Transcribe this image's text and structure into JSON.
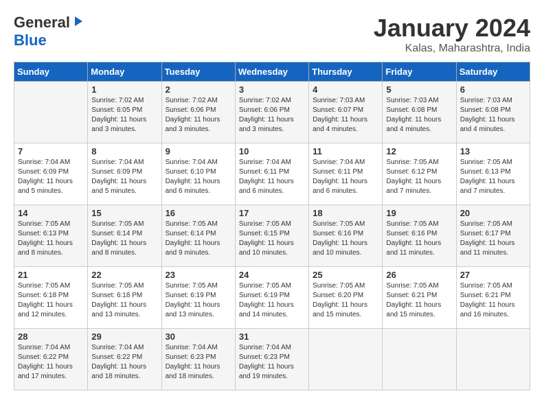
{
  "header": {
    "logo_general": "General",
    "logo_blue": "Blue",
    "title": "January 2024",
    "subtitle": "Kalas, Maharashtra, India"
  },
  "days_of_week": [
    "Sunday",
    "Monday",
    "Tuesday",
    "Wednesday",
    "Thursday",
    "Friday",
    "Saturday"
  ],
  "weeks": [
    {
      "cells": [
        {
          "day": null,
          "info": null
        },
        {
          "day": "1",
          "info": "Sunrise: 7:02 AM\nSunset: 6:05 PM\nDaylight: 11 hours\nand 3 minutes."
        },
        {
          "day": "2",
          "info": "Sunrise: 7:02 AM\nSunset: 6:06 PM\nDaylight: 11 hours\nand 3 minutes."
        },
        {
          "day": "3",
          "info": "Sunrise: 7:02 AM\nSunset: 6:06 PM\nDaylight: 11 hours\nand 3 minutes."
        },
        {
          "day": "4",
          "info": "Sunrise: 7:03 AM\nSunset: 6:07 PM\nDaylight: 11 hours\nand 4 minutes."
        },
        {
          "day": "5",
          "info": "Sunrise: 7:03 AM\nSunset: 6:08 PM\nDaylight: 11 hours\nand 4 minutes."
        },
        {
          "day": "6",
          "info": "Sunrise: 7:03 AM\nSunset: 6:08 PM\nDaylight: 11 hours\nand 4 minutes."
        }
      ]
    },
    {
      "cells": [
        {
          "day": "7",
          "info": "Sunrise: 7:04 AM\nSunset: 6:09 PM\nDaylight: 11 hours\nand 5 minutes."
        },
        {
          "day": "8",
          "info": "Sunrise: 7:04 AM\nSunset: 6:09 PM\nDaylight: 11 hours\nand 5 minutes."
        },
        {
          "day": "9",
          "info": "Sunrise: 7:04 AM\nSunset: 6:10 PM\nDaylight: 11 hours\nand 6 minutes."
        },
        {
          "day": "10",
          "info": "Sunrise: 7:04 AM\nSunset: 6:11 PM\nDaylight: 11 hours\nand 6 minutes."
        },
        {
          "day": "11",
          "info": "Sunrise: 7:04 AM\nSunset: 6:11 PM\nDaylight: 11 hours\nand 6 minutes."
        },
        {
          "day": "12",
          "info": "Sunrise: 7:05 AM\nSunset: 6:12 PM\nDaylight: 11 hours\nand 7 minutes."
        },
        {
          "day": "13",
          "info": "Sunrise: 7:05 AM\nSunset: 6:13 PM\nDaylight: 11 hours\nand 7 minutes."
        }
      ]
    },
    {
      "cells": [
        {
          "day": "14",
          "info": "Sunrise: 7:05 AM\nSunset: 6:13 PM\nDaylight: 11 hours\nand 8 minutes."
        },
        {
          "day": "15",
          "info": "Sunrise: 7:05 AM\nSunset: 6:14 PM\nDaylight: 11 hours\nand 8 minutes."
        },
        {
          "day": "16",
          "info": "Sunrise: 7:05 AM\nSunset: 6:14 PM\nDaylight: 11 hours\nand 9 minutes."
        },
        {
          "day": "17",
          "info": "Sunrise: 7:05 AM\nSunset: 6:15 PM\nDaylight: 11 hours\nand 10 minutes."
        },
        {
          "day": "18",
          "info": "Sunrise: 7:05 AM\nSunset: 6:16 PM\nDaylight: 11 hours\nand 10 minutes."
        },
        {
          "day": "19",
          "info": "Sunrise: 7:05 AM\nSunset: 6:16 PM\nDaylight: 11 hours\nand 11 minutes."
        },
        {
          "day": "20",
          "info": "Sunrise: 7:05 AM\nSunset: 6:17 PM\nDaylight: 11 hours\nand 11 minutes."
        }
      ]
    },
    {
      "cells": [
        {
          "day": "21",
          "info": "Sunrise: 7:05 AM\nSunset: 6:18 PM\nDaylight: 11 hours\nand 12 minutes."
        },
        {
          "day": "22",
          "info": "Sunrise: 7:05 AM\nSunset: 6:18 PM\nDaylight: 11 hours\nand 13 minutes."
        },
        {
          "day": "23",
          "info": "Sunrise: 7:05 AM\nSunset: 6:19 PM\nDaylight: 11 hours\nand 13 minutes."
        },
        {
          "day": "24",
          "info": "Sunrise: 7:05 AM\nSunset: 6:19 PM\nDaylight: 11 hours\nand 14 minutes."
        },
        {
          "day": "25",
          "info": "Sunrise: 7:05 AM\nSunset: 6:20 PM\nDaylight: 11 hours\nand 15 minutes."
        },
        {
          "day": "26",
          "info": "Sunrise: 7:05 AM\nSunset: 6:21 PM\nDaylight: 11 hours\nand 15 minutes."
        },
        {
          "day": "27",
          "info": "Sunrise: 7:05 AM\nSunset: 6:21 PM\nDaylight: 11 hours\nand 16 minutes."
        }
      ]
    },
    {
      "cells": [
        {
          "day": "28",
          "info": "Sunrise: 7:04 AM\nSunset: 6:22 PM\nDaylight: 11 hours\nand 17 minutes."
        },
        {
          "day": "29",
          "info": "Sunrise: 7:04 AM\nSunset: 6:22 PM\nDaylight: 11 hours\nand 18 minutes."
        },
        {
          "day": "30",
          "info": "Sunrise: 7:04 AM\nSunset: 6:23 PM\nDaylight: 11 hours\nand 18 minutes."
        },
        {
          "day": "31",
          "info": "Sunrise: 7:04 AM\nSunset: 6:23 PM\nDaylight: 11 hours\nand 19 minutes."
        },
        {
          "day": null,
          "info": null
        },
        {
          "day": null,
          "info": null
        },
        {
          "day": null,
          "info": null
        }
      ]
    }
  ]
}
